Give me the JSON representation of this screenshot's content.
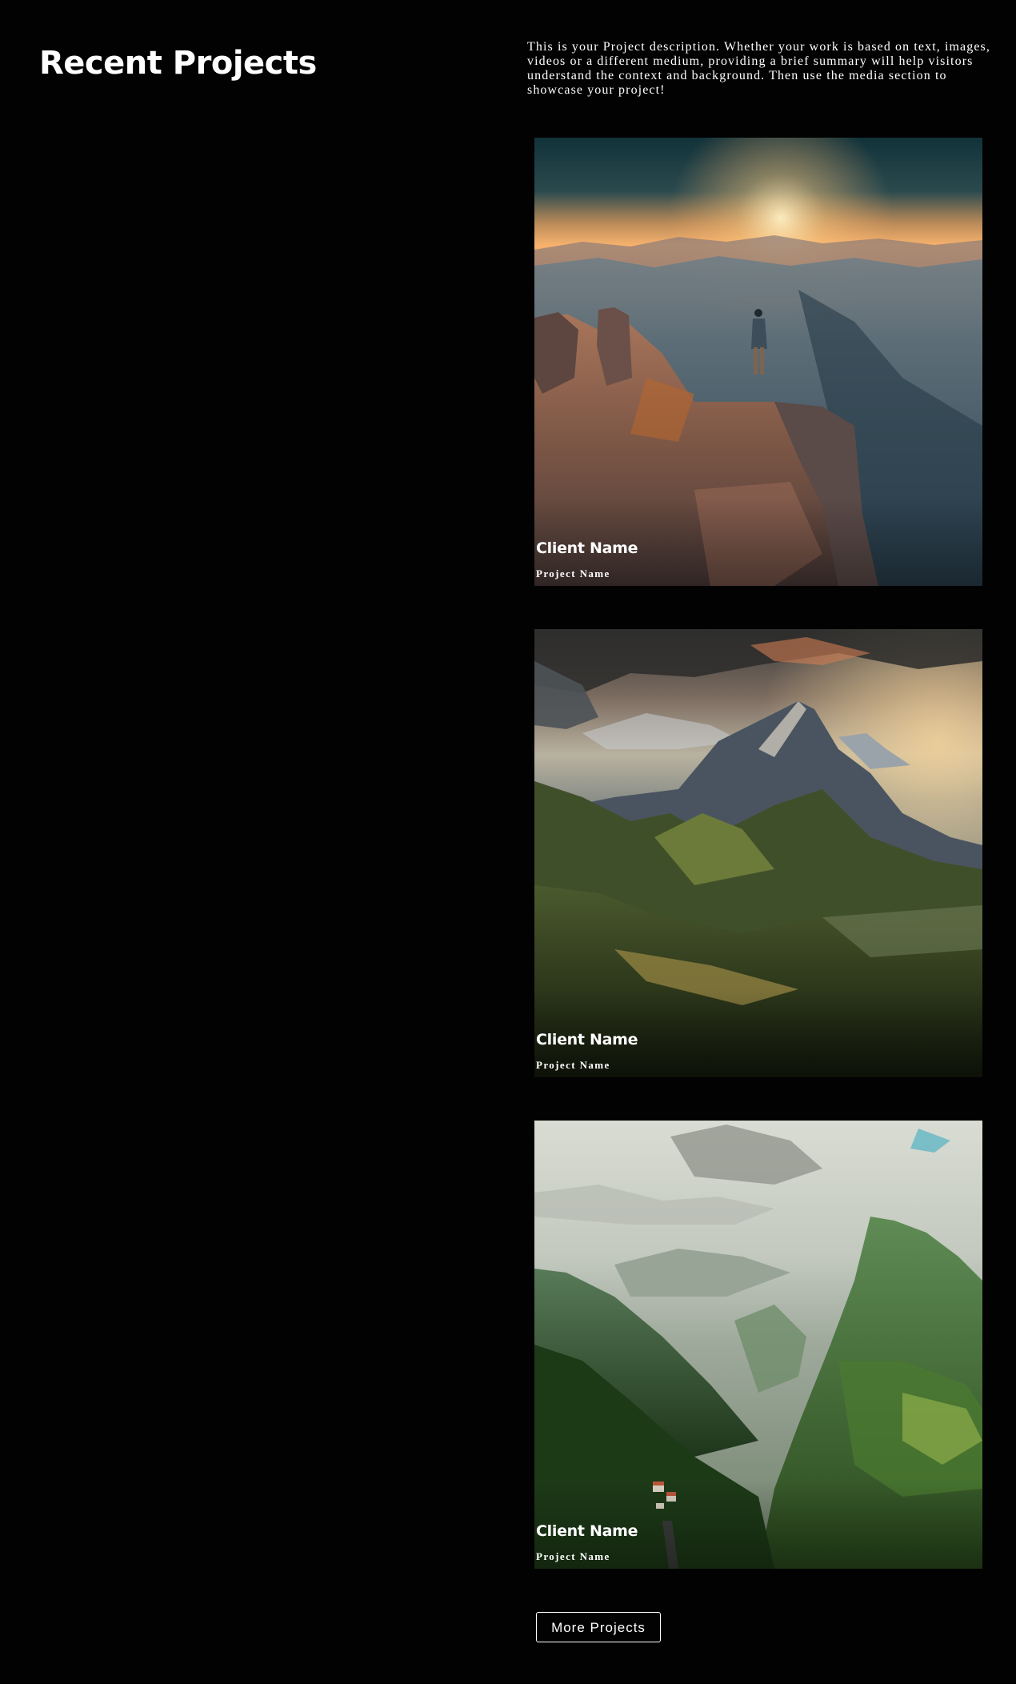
{
  "header": {
    "title": "Recent Projects",
    "description": "This is your Project description. Whether your work is based on text, images, videos or a different medium, providing a brief summary will help visitors understand the context and background. Then use the media section to showcase your project!"
  },
  "projects": [
    {
      "client_name": "Client Name",
      "project_name": "Project Name",
      "image": "hiker-on-cliff-at-sunset"
    },
    {
      "client_name": "Client Name",
      "project_name": "Project Name",
      "image": "mountain-peaks-over-forest-valley"
    },
    {
      "client_name": "Client Name",
      "project_name": "Project Name",
      "image": "green-mountain-valley-with-village"
    }
  ],
  "more_button": {
    "label": "More Projects"
  }
}
